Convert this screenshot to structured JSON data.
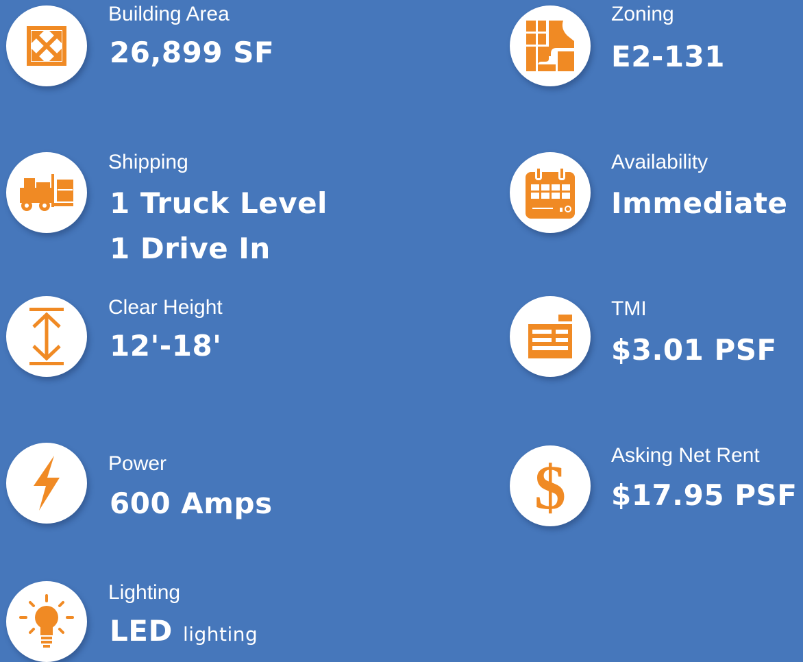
{
  "accent_color": "#f08a24",
  "background_color": "#4677bb",
  "left_column": {
    "building_area": {
      "icon": "expand-arrows-icon",
      "label": "Building Area",
      "value": "26,899 SF"
    },
    "shipping": {
      "icon": "forklift-icon",
      "label": "Shipping",
      "value_line1": "1 Truck Level",
      "value_line2": "1 Drive In"
    },
    "clear_height": {
      "icon": "vertical-height-icon",
      "label": "Clear Height",
      "value": "12'-18'"
    },
    "power": {
      "icon": "lightning-bolt-icon",
      "label": "Power",
      "value": "600 Amps"
    },
    "lighting": {
      "icon": "light-bulb-icon",
      "label": "Lighting",
      "value_main": "LED",
      "value_suffix": "lighting"
    }
  },
  "right_column": {
    "zoning": {
      "icon": "zoning-map-icon",
      "label": "Zoning",
      "value": "E2-131"
    },
    "availability": {
      "icon": "calendar-icon",
      "label": "Availability",
      "value": "Immediate"
    },
    "tmi": {
      "icon": "invoice-icon",
      "label": "TMI",
      "value": "$3.01 PSF"
    },
    "asking_net_rent": {
      "icon": "dollar-sign-icon",
      "label": "Asking Net Rent",
      "value": "$17.95 PSF"
    }
  }
}
